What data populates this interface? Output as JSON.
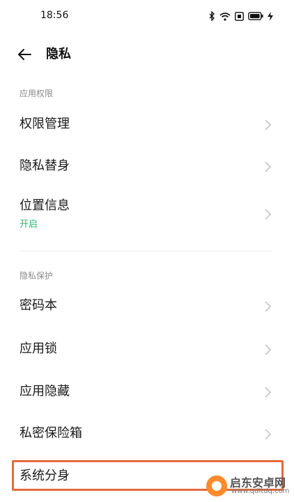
{
  "status_bar": {
    "time": "18:56",
    "icons": [
      "bluetooth-icon",
      "wifi-icon",
      "nfc-icon",
      "battery-icon",
      "charging-icon"
    ]
  },
  "header": {
    "back_icon": "arrow-left-icon",
    "title": "隐私"
  },
  "sections": [
    {
      "label": "应用权限",
      "items": [
        {
          "label": "权限管理"
        },
        {
          "label": "隐私替身"
        },
        {
          "label": "位置信息",
          "sub": "开启"
        }
      ]
    },
    {
      "label": "隐私保护",
      "items": [
        {
          "label": "密码本"
        },
        {
          "label": "应用锁"
        },
        {
          "label": "应用隐藏"
        },
        {
          "label": "私密保险箱"
        },
        {
          "label": "系统分身"
        }
      ]
    }
  ],
  "colors": {
    "accent_green": "#2fb36a",
    "highlight_border": "#e66a3a",
    "section_label": "#8a8a8a"
  },
  "watermark": {
    "name": "启东安卓网",
    "url": "www.qdltdq.com"
  }
}
